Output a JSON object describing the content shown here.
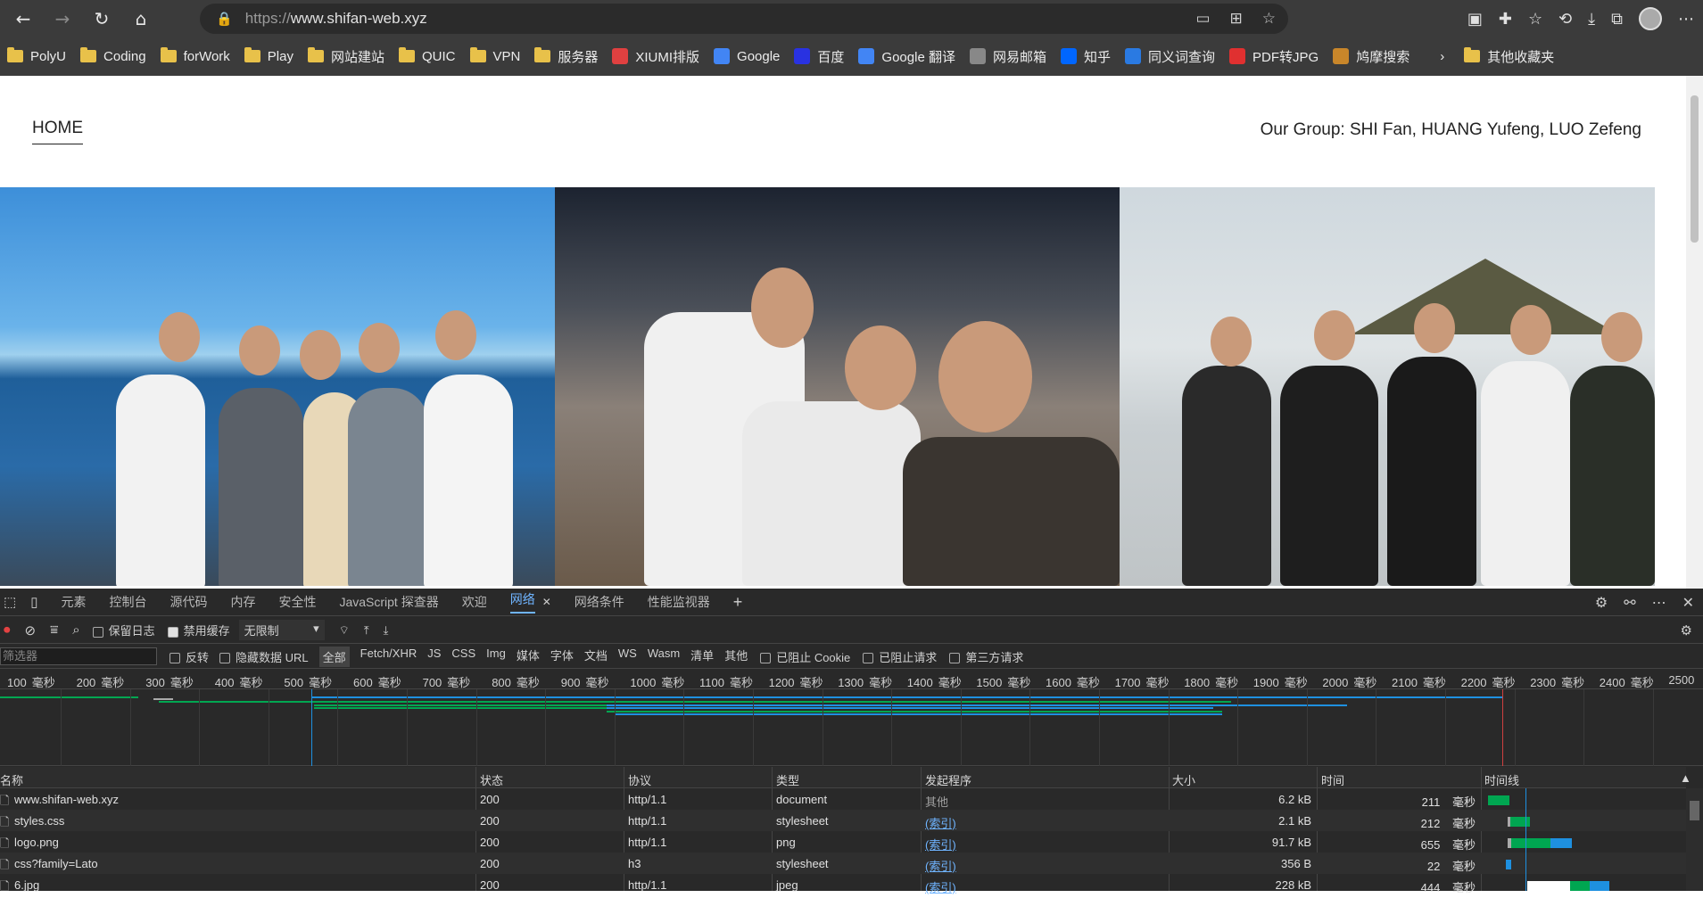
{
  "browser": {
    "url_prefix": "https://",
    "url_host": "www.shifan-web.xyz",
    "bookmarks": [
      {
        "label": "PolyU",
        "kind": "folder"
      },
      {
        "label": "Coding",
        "kind": "folder"
      },
      {
        "label": "forWork",
        "kind": "folder"
      },
      {
        "label": "Play",
        "kind": "folder"
      },
      {
        "label": "网站建站",
        "kind": "folder"
      },
      {
        "label": "QUIC",
        "kind": "folder"
      },
      {
        "label": "VPN",
        "kind": "folder"
      },
      {
        "label": "服务器",
        "kind": "folder"
      },
      {
        "label": "XIUMI排版",
        "kind": "site"
      },
      {
        "label": "Google",
        "kind": "site"
      },
      {
        "label": "百度",
        "kind": "site"
      },
      {
        "label": "Google 翻译",
        "kind": "site"
      },
      {
        "label": "网易邮箱",
        "kind": "site"
      },
      {
        "label": "知乎",
        "kind": "site"
      },
      {
        "label": "同义词查询",
        "kind": "site"
      },
      {
        "label": "PDF转JPG",
        "kind": "site"
      },
      {
        "label": "鸠摩搜索",
        "kind": "site"
      }
    ],
    "other_bookmarks": "其他收藏夹"
  },
  "site": {
    "nav_home": "HOME",
    "group_text": "Our Group: SHI Fan, HUANG Yufeng, LUO Zefeng"
  },
  "devtools": {
    "tabs": [
      "元素",
      "控制台",
      "源代码",
      "内存",
      "安全性",
      "JavaScript 探查器",
      "欢迎",
      "网络",
      "网络条件",
      "性能监视器"
    ],
    "active_tab": "网络",
    "toolbar": {
      "preserve_log": "保留日志",
      "disable_cache": "禁用缓存",
      "throttle": "无限制"
    },
    "filter": {
      "placeholder": "筛选器",
      "invert": "反转",
      "hide_data_urls": "隐藏数据 URL",
      "types": [
        "全部",
        "Fetch/XHR",
        "JS",
        "CSS",
        "Img",
        "媒体",
        "字体",
        "文档",
        "WS",
        "Wasm",
        "清单",
        "其他"
      ],
      "blocked_cookies": "已阻止 Cookie",
      "blocked_requests": "已阻止请求",
      "third_party": "第三方请求"
    },
    "ruler_unit": "毫秒",
    "ruler_ticks": [
      "100",
      "200",
      "300",
      "400",
      "500",
      "600",
      "700",
      "800",
      "900",
      "1000",
      "1100",
      "1200",
      "1300",
      "1400",
      "1500",
      "1600",
      "1700",
      "1800",
      "1900",
      "2000",
      "2100",
      "2200",
      "2300",
      "2400",
      "2500"
    ],
    "columns": [
      "名称",
      "状态",
      "协议",
      "类型",
      "发起程序",
      "大小",
      "时间",
      "时间线"
    ],
    "rows": [
      {
        "name": "www.shifan-web.xyz",
        "status": "200",
        "protocol": "http/1.1",
        "type": "document",
        "initiator": "其他",
        "size": "6.2 kB",
        "time": "211",
        "time_unit": "毫秒"
      },
      {
        "name": "styles.css",
        "status": "200",
        "protocol": "http/1.1",
        "type": "stylesheet",
        "initiator": "(索引)",
        "size": "2.1 kB",
        "time": "212",
        "time_unit": "毫秒"
      },
      {
        "name": "logo.png",
        "status": "200",
        "protocol": "http/1.1",
        "type": "png",
        "initiator": "(索引)",
        "size": "91.7 kB",
        "time": "655",
        "time_unit": "毫秒"
      },
      {
        "name": "css?family=Lato",
        "status": "200",
        "protocol": "h3",
        "type": "stylesheet",
        "initiator": "(索引)",
        "size": "356 B",
        "time": "22",
        "time_unit": "毫秒"
      },
      {
        "name": "6.jpg",
        "status": "200",
        "protocol": "http/1.1",
        "type": "jpeg",
        "initiator": "(索引)",
        "size": "228 kB",
        "time": "444",
        "time_unit": "毫秒"
      }
    ],
    "colors": {
      "accent": "#6fb4ff",
      "waiting": "#00a651",
      "download": "#1e90e0"
    }
  }
}
